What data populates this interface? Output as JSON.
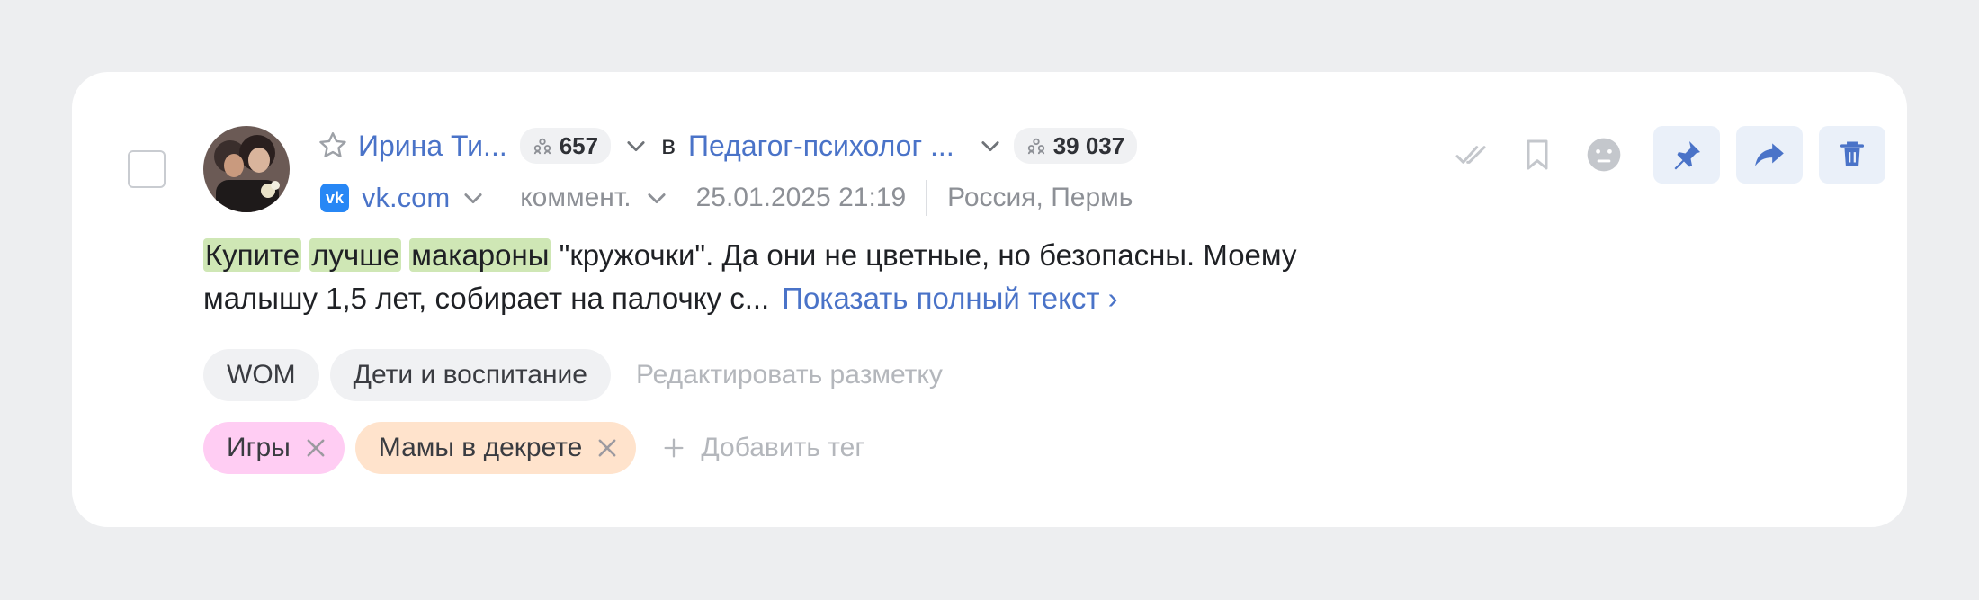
{
  "author": {
    "name": "Ирина Ти...",
    "followers": "657"
  },
  "in_word": "в",
  "community": {
    "name": "Педагог-психолог ...",
    "members": "39 037"
  },
  "source": {
    "site": "vk.com",
    "type": "коммент.",
    "datetime": "25.01.2025 21:19",
    "location": "Россия, Пермь"
  },
  "post": {
    "hl1": "Купите",
    "hl2": "лучше",
    "hl3": "макароны",
    "rest_line1": "\"кружочки\". Да они не цветные, но безопасны. Моему",
    "rest_line2": "малышу 1,5 лет, собирает на палочку с...",
    "show_more": "Показать полный текст ›"
  },
  "markup_tags": [
    "WOM",
    "Дети и воспитание"
  ],
  "edit_markup": "Редактировать разметку",
  "user_tags": [
    {
      "label": "Игры",
      "color": "#ffcdf3"
    },
    {
      "label": "Мамы в декрете",
      "color": "#ffe3cc"
    }
  ],
  "add_tag": "Добавить тег",
  "colors": {
    "accent": "#4a73c8",
    "highlight": "#cfe7b5",
    "action_bg": "#eaf0f9"
  }
}
